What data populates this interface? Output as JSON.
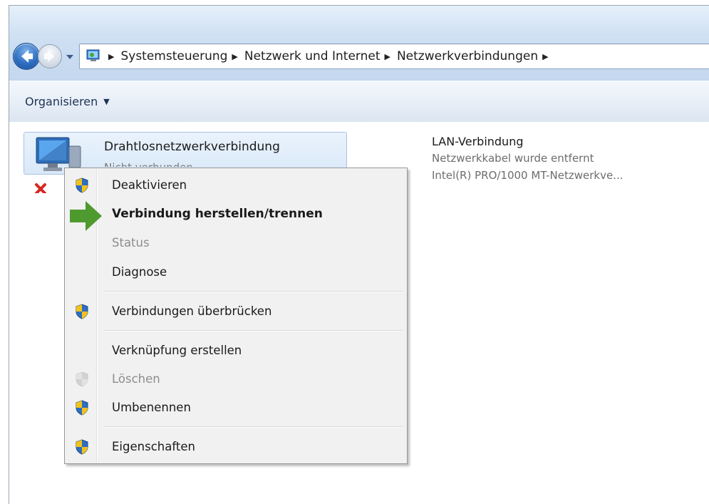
{
  "address": {
    "breadcrumbs": [
      "Systemsteuerung",
      "Netzwerk und Internet",
      "Netzwerkverbindungen"
    ]
  },
  "toolbar": {
    "organize_label": "Organisieren"
  },
  "items": {
    "wireless": {
      "name": "Drahtlosnetzwerkverbindung",
      "status": "Nicht verbunden"
    },
    "lan": {
      "name": "LAN-Verbindung",
      "status": "Netzwerkkabel wurde entfernt",
      "adapter": "Intel(R) PRO/1000 MT-Netzwerkve..."
    }
  },
  "context_menu": {
    "items": [
      {
        "label": "Deaktivieren",
        "shield": true,
        "bold": false,
        "disabled": false
      },
      {
        "label": "Verbindung herstellen/trennen",
        "shield": false,
        "bold": true,
        "disabled": false
      },
      {
        "label": "Status",
        "shield": false,
        "bold": false,
        "disabled": true
      },
      {
        "label": "Diagnose",
        "shield": false,
        "bold": false,
        "disabled": false
      },
      {
        "label": "Verbindungen überbrücken",
        "shield": true,
        "bold": false,
        "disabled": false
      },
      {
        "label": "Verknüpfung erstellen",
        "shield": false,
        "bold": false,
        "disabled": false
      },
      {
        "label": "Löschen",
        "shield": true,
        "bold": false,
        "disabled": true
      },
      {
        "label": "Umbenennen",
        "shield": true,
        "bold": false,
        "disabled": false
      },
      {
        "label": "Eigenschaften",
        "shield": true,
        "bold": false,
        "disabled": false
      }
    ]
  },
  "colors": {
    "highlight_arrow": "#4f9a2e",
    "error_x": "#d8261e",
    "shield_blue": "#2f6fc1",
    "shield_yellow": "#f2c21b"
  }
}
